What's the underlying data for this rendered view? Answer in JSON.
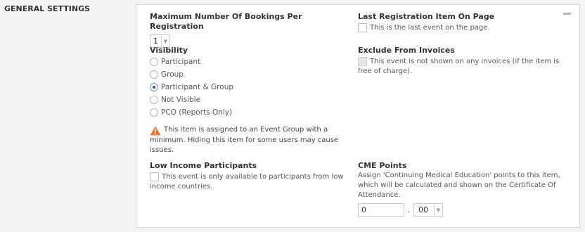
{
  "section_title": "GENERAL SETTINGS",
  "max_bookings": {
    "label": "Maximum Number Of Bookings Per Registration",
    "selected": "1"
  },
  "visibility": {
    "label": "Visibility",
    "options": [
      {
        "label": "Participant",
        "checked": false
      },
      {
        "label": "Group",
        "checked": false
      },
      {
        "label": "Participant & Group",
        "checked": true
      },
      {
        "label": "Not Visible",
        "checked": false
      },
      {
        "label": "PCO (Reports Only)",
        "checked": false
      }
    ],
    "warning_line1": "This item is assigned to an Event Group with a",
    "warning_line2": "minimum. Hiding this item for some users may cause",
    "warning_line3": "issues."
  },
  "low_income": {
    "label": "Low Income Participants",
    "text_line1": "This event is only available to participants from low",
    "text_line2": "income countries."
  },
  "last_item": {
    "label": "Last Registration Item On Page",
    "text": "This is the last event on the page."
  },
  "exclude_invoices": {
    "label": "Exclude From Invoices",
    "text_line1": "This event is not shown on any invoices (if the item is",
    "text_line2": "free of charge)."
  },
  "cme": {
    "label": "CME Points",
    "desc_line1": "Assign 'Continuing Medical Education' points to this item,",
    "desc_line2": "which will be calculated and shown on the Certificate Of",
    "desc_line3": "Attendance.",
    "whole_value": "0",
    "separator": ".",
    "decimal_value": "00"
  },
  "colors": {
    "warning": "#e8762d",
    "radio_checked": "#2a4f8c"
  }
}
